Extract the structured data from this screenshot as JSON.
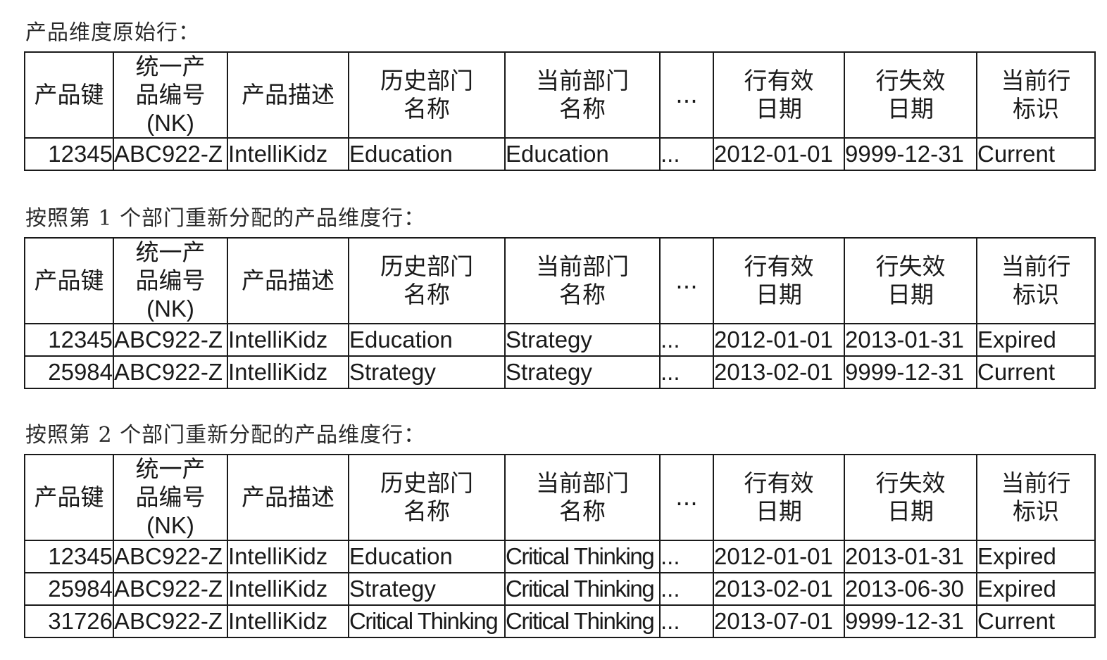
{
  "headers": {
    "product_key": "产品键",
    "natural_key_line1": "统一产",
    "natural_key_line2": "品编号",
    "natural_key_line3": "(NK)",
    "product_desc": "产品描述",
    "hist_dept_line1": "历史部门",
    "hist_dept_line2": "名称",
    "curr_dept_line1": "当前部门",
    "curr_dept_line2": "名称",
    "ellipsis": "...",
    "row_eff_line1": "行有效",
    "row_eff_line2": "日期",
    "row_exp_line1": "行失效",
    "row_exp_line2": "日期",
    "current_flag_line1": "当前行",
    "current_flag_line2": "标识"
  },
  "sections": [
    {
      "title": "产品维度原始行：",
      "rows": [
        {
          "key": "12345",
          "nk": "ABC922-Z",
          "desc": "IntelliKidz",
          "hist": "Education",
          "curr": "Education",
          "more": "...",
          "eff": "2012-01-01",
          "exp": "9999-12-31",
          "flag": "Current"
        }
      ]
    },
    {
      "title": "按照第 1 个部门重新分配的产品维度行：",
      "rows": [
        {
          "key": "12345",
          "nk": "ABC922-Z",
          "desc": "IntelliKidz",
          "hist": "Education",
          "curr": "Strategy",
          "more": "...",
          "eff": "2012-01-01",
          "exp": "2013-01-31",
          "flag": "Expired"
        },
        {
          "key": "25984",
          "nk": "ABC922-Z",
          "desc": "IntelliKidz",
          "hist": "Strategy",
          "curr": "Strategy",
          "more": "...",
          "eff": "2013-02-01",
          "exp": "9999-12-31",
          "flag": "Current"
        }
      ]
    },
    {
      "title": "按照第 2 个部门重新分配的产品维度行：",
      "rows": [
        {
          "key": "12345",
          "nk": "ABC922-Z",
          "desc": "IntelliKidz",
          "hist": "Education",
          "curr": "Critical Thinking",
          "more": "...",
          "eff": "2012-01-01",
          "exp": "2013-01-31",
          "flag": "Expired"
        },
        {
          "key": "25984",
          "nk": "ABC922-Z",
          "desc": "IntelliKidz",
          "hist": "Strategy",
          "curr": "Critical Thinking",
          "more": "...",
          "eff": "2013-02-01",
          "exp": "2013-06-30",
          "flag": "Expired"
        },
        {
          "key": "31726",
          "nk": "ABC922-Z",
          "desc": "IntelliKidz",
          "hist": "Critical Thinking",
          "curr": "Critical Thinking",
          "more": "...",
          "eff": "2013-07-01",
          "exp": "9999-12-31",
          "flag": "Current"
        }
      ]
    }
  ]
}
